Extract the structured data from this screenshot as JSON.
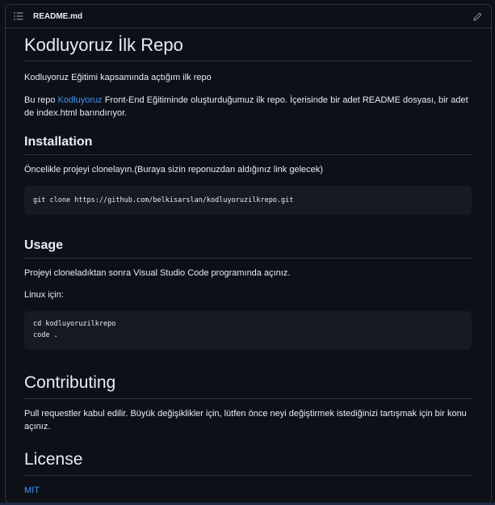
{
  "header": {
    "filename": "README.md"
  },
  "readme": {
    "title": "Kodluyoruz İlk Repo",
    "intro": "Kodluyoruz Eğitimi kapsamında açtığım ilk repo",
    "desc_pre": "Bu repo ",
    "desc_link": "Kodluyoruz",
    "desc_post": " Front-End Eğitiminde oluşturduğumuz ilk repo. İçerisinde bir adet README dosyası, bir adet de index.html barındırıyor.",
    "installation": {
      "heading": "Installation",
      "text": "Öncelikle projeyi clonelayın.(Buraya sizin reponuzdan aldığınız link gelecek)",
      "code": "git clone https://github.com/belkisarslan/kodluyoruzilkrepo.git"
    },
    "usage": {
      "heading": "Usage",
      "text": "Projeyi cloneladıktan sonra Visual Studio Code programında açınız.",
      "linux": "Linux için:",
      "code_line1": "cd kodluyoruzilkrepo",
      "code_line2": "code ."
    },
    "contributing": {
      "heading": "Contributing",
      "text": "Pull requestler kabul edilir. Büyük değişiklikler için, lütfen önce neyi değiştirmek istediğinizi tartışmak için bir konu açınız."
    },
    "license": {
      "heading": "License",
      "link": "MIT"
    }
  },
  "colors": {
    "background": "#0d1117",
    "code_bg": "#161b22",
    "link": "#4493f8",
    "border": "#30363d"
  },
  "icons": {
    "outline": "list-icon",
    "edit": "pencil-icon"
  }
}
